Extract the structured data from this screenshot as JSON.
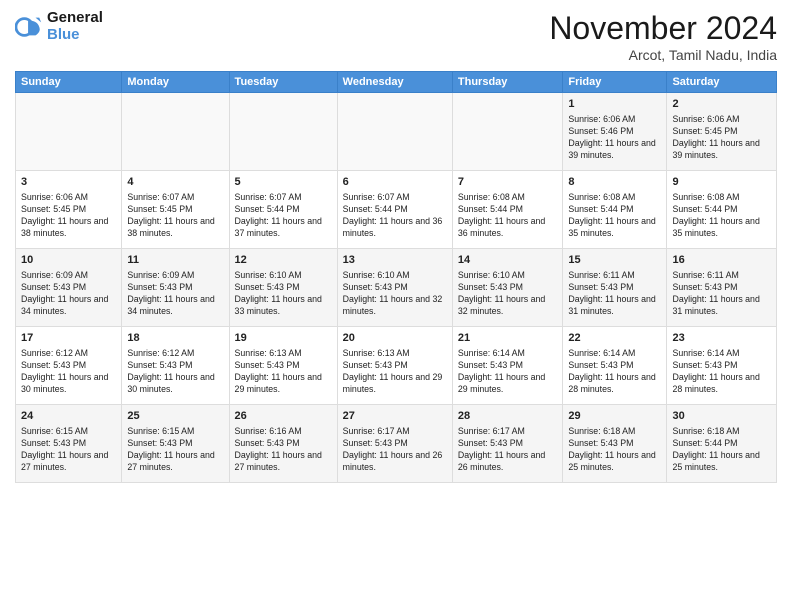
{
  "logo": {
    "line1": "General",
    "line2": "Blue"
  },
  "title": "November 2024",
  "location": "Arcot, Tamil Nadu, India",
  "weekdays": [
    "Sunday",
    "Monday",
    "Tuesday",
    "Wednesday",
    "Thursday",
    "Friday",
    "Saturday"
  ],
  "weeks": [
    [
      {
        "day": "",
        "text": ""
      },
      {
        "day": "",
        "text": ""
      },
      {
        "day": "",
        "text": ""
      },
      {
        "day": "",
        "text": ""
      },
      {
        "day": "",
        "text": ""
      },
      {
        "day": "1",
        "text": "Sunrise: 6:06 AM\nSunset: 5:46 PM\nDaylight: 11 hours and 39 minutes."
      },
      {
        "day": "2",
        "text": "Sunrise: 6:06 AM\nSunset: 5:45 PM\nDaylight: 11 hours and 39 minutes."
      }
    ],
    [
      {
        "day": "3",
        "text": "Sunrise: 6:06 AM\nSunset: 5:45 PM\nDaylight: 11 hours and 38 minutes."
      },
      {
        "day": "4",
        "text": "Sunrise: 6:07 AM\nSunset: 5:45 PM\nDaylight: 11 hours and 38 minutes."
      },
      {
        "day": "5",
        "text": "Sunrise: 6:07 AM\nSunset: 5:44 PM\nDaylight: 11 hours and 37 minutes."
      },
      {
        "day": "6",
        "text": "Sunrise: 6:07 AM\nSunset: 5:44 PM\nDaylight: 11 hours and 36 minutes."
      },
      {
        "day": "7",
        "text": "Sunrise: 6:08 AM\nSunset: 5:44 PM\nDaylight: 11 hours and 36 minutes."
      },
      {
        "day": "8",
        "text": "Sunrise: 6:08 AM\nSunset: 5:44 PM\nDaylight: 11 hours and 35 minutes."
      },
      {
        "day": "9",
        "text": "Sunrise: 6:08 AM\nSunset: 5:44 PM\nDaylight: 11 hours and 35 minutes."
      }
    ],
    [
      {
        "day": "10",
        "text": "Sunrise: 6:09 AM\nSunset: 5:43 PM\nDaylight: 11 hours and 34 minutes."
      },
      {
        "day": "11",
        "text": "Sunrise: 6:09 AM\nSunset: 5:43 PM\nDaylight: 11 hours and 34 minutes."
      },
      {
        "day": "12",
        "text": "Sunrise: 6:10 AM\nSunset: 5:43 PM\nDaylight: 11 hours and 33 minutes."
      },
      {
        "day": "13",
        "text": "Sunrise: 6:10 AM\nSunset: 5:43 PM\nDaylight: 11 hours and 32 minutes."
      },
      {
        "day": "14",
        "text": "Sunrise: 6:10 AM\nSunset: 5:43 PM\nDaylight: 11 hours and 32 minutes."
      },
      {
        "day": "15",
        "text": "Sunrise: 6:11 AM\nSunset: 5:43 PM\nDaylight: 11 hours and 31 minutes."
      },
      {
        "day": "16",
        "text": "Sunrise: 6:11 AM\nSunset: 5:43 PM\nDaylight: 11 hours and 31 minutes."
      }
    ],
    [
      {
        "day": "17",
        "text": "Sunrise: 6:12 AM\nSunset: 5:43 PM\nDaylight: 11 hours and 30 minutes."
      },
      {
        "day": "18",
        "text": "Sunrise: 6:12 AM\nSunset: 5:43 PM\nDaylight: 11 hours and 30 minutes."
      },
      {
        "day": "19",
        "text": "Sunrise: 6:13 AM\nSunset: 5:43 PM\nDaylight: 11 hours and 29 minutes."
      },
      {
        "day": "20",
        "text": "Sunrise: 6:13 AM\nSunset: 5:43 PM\nDaylight: 11 hours and 29 minutes."
      },
      {
        "day": "21",
        "text": "Sunrise: 6:14 AM\nSunset: 5:43 PM\nDaylight: 11 hours and 29 minutes."
      },
      {
        "day": "22",
        "text": "Sunrise: 6:14 AM\nSunset: 5:43 PM\nDaylight: 11 hours and 28 minutes."
      },
      {
        "day": "23",
        "text": "Sunrise: 6:14 AM\nSunset: 5:43 PM\nDaylight: 11 hours and 28 minutes."
      }
    ],
    [
      {
        "day": "24",
        "text": "Sunrise: 6:15 AM\nSunset: 5:43 PM\nDaylight: 11 hours and 27 minutes."
      },
      {
        "day": "25",
        "text": "Sunrise: 6:15 AM\nSunset: 5:43 PM\nDaylight: 11 hours and 27 minutes."
      },
      {
        "day": "26",
        "text": "Sunrise: 6:16 AM\nSunset: 5:43 PM\nDaylight: 11 hours and 27 minutes."
      },
      {
        "day": "27",
        "text": "Sunrise: 6:17 AM\nSunset: 5:43 PM\nDaylight: 11 hours and 26 minutes."
      },
      {
        "day": "28",
        "text": "Sunrise: 6:17 AM\nSunset: 5:43 PM\nDaylight: 11 hours and 26 minutes."
      },
      {
        "day": "29",
        "text": "Sunrise: 6:18 AM\nSunset: 5:43 PM\nDaylight: 11 hours and 25 minutes."
      },
      {
        "day": "30",
        "text": "Sunrise: 6:18 AM\nSunset: 5:44 PM\nDaylight: 11 hours and 25 minutes."
      }
    ]
  ]
}
